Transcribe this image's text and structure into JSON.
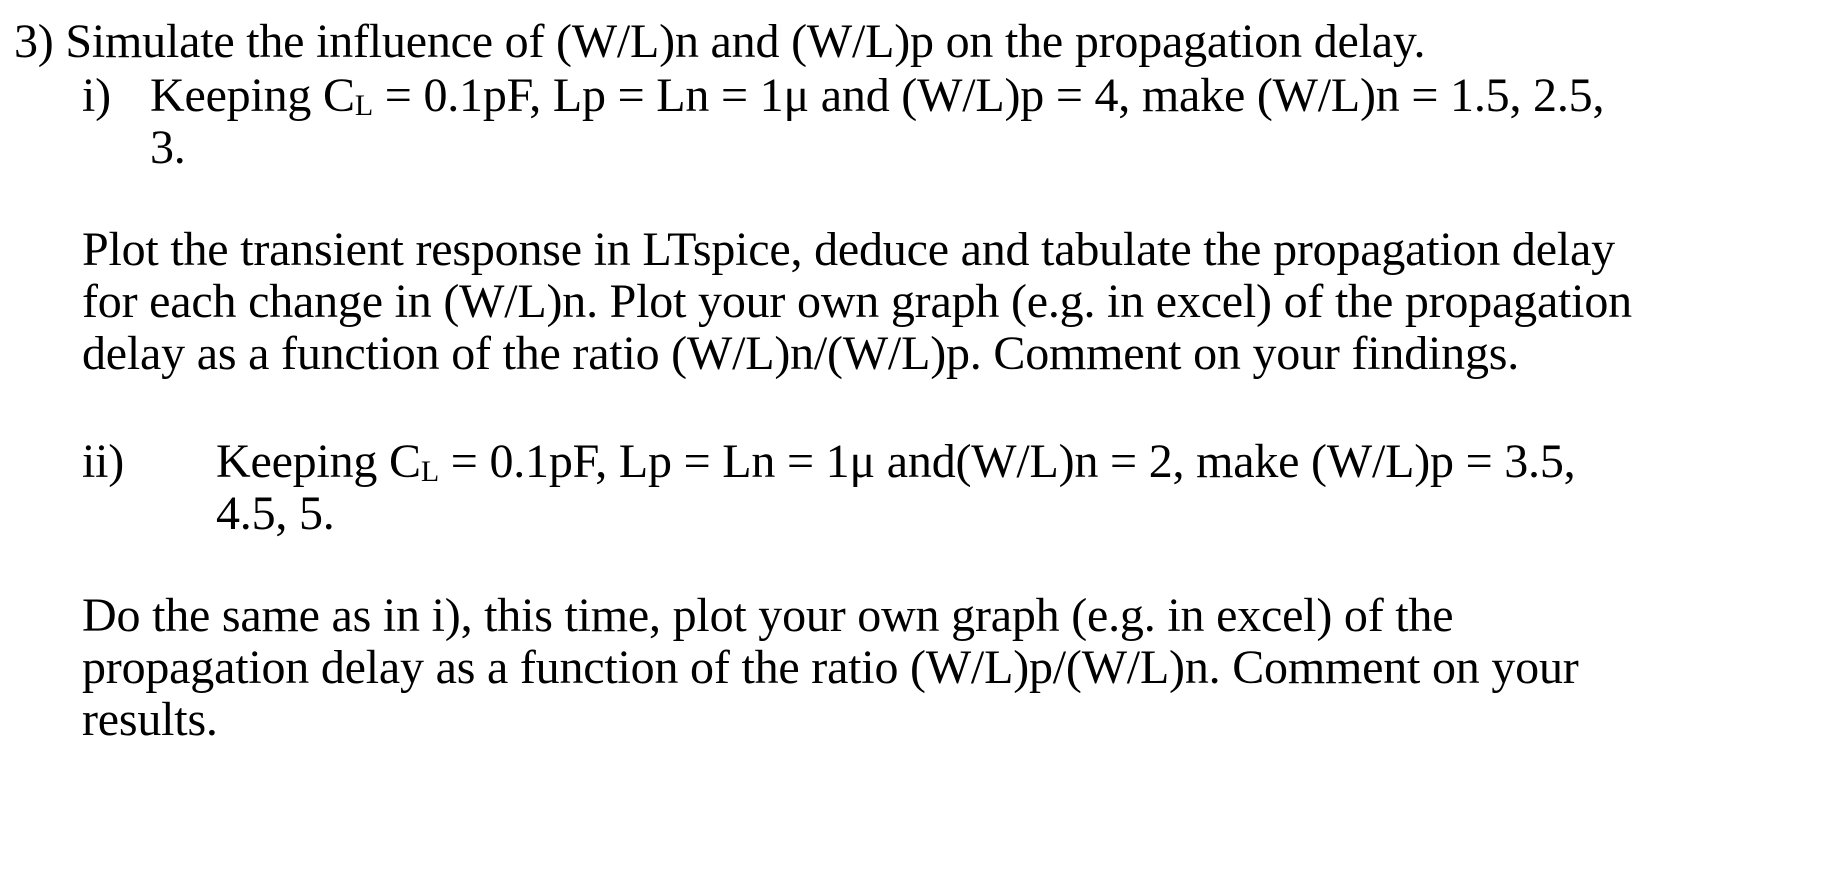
{
  "question": {
    "heading": "3) Simulate the influence of (W/L)n and (W/L)p on the propagation delay.",
    "part_i": {
      "marker": "i)",
      "line1_a": "Keeping C",
      "line1_sub": "L",
      "line1_b": " = 0.1pF, Lp = Ln = 1μ and (W/L)p = 4, make (W/L)n = 1.5, 2.5,",
      "line2": "3."
    },
    "paragraph_1": [
      "Plot the transient response in LTspice, deduce and tabulate the propagation delay",
      "for each change in (W/L)n. Plot your own graph (e.g. in excel) of the propagation",
      "delay as a function of the ratio (W/L)n/(W/L)p. Comment on your findings."
    ],
    "part_ii": {
      "marker": "ii)",
      "line1_a": "Keeping C",
      "line1_sub": "L",
      "line1_b": " = 0.1pF, Lp = Ln = 1μ and(W/L)n = 2, make (W/L)p = 3.5,",
      "line2": "4.5, 5."
    },
    "paragraph_2": [
      "Do the same as in i), this time, plot your own graph (e.g. in excel) of the",
      "propagation delay as a function of the ratio (W/L)p/(W/L)n. Comment on your",
      "results."
    ]
  }
}
